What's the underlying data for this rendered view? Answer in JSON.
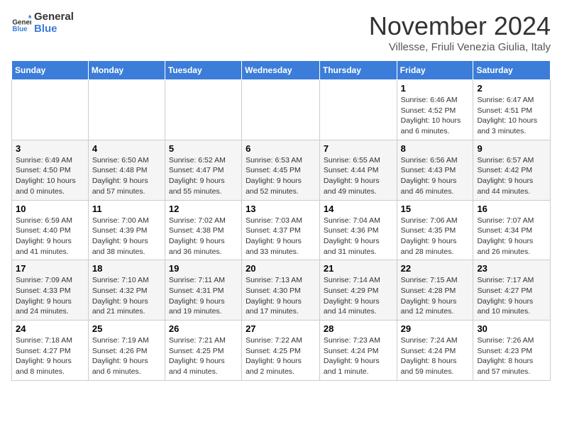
{
  "logo": {
    "line1": "General",
    "line2": "Blue"
  },
  "title": "November 2024",
  "subtitle": "Villesse, Friuli Venezia Giulia, Italy",
  "days_of_week": [
    "Sunday",
    "Monday",
    "Tuesday",
    "Wednesday",
    "Thursday",
    "Friday",
    "Saturday"
  ],
  "weeks": [
    [
      {
        "day": "",
        "info": ""
      },
      {
        "day": "",
        "info": ""
      },
      {
        "day": "",
        "info": ""
      },
      {
        "day": "",
        "info": ""
      },
      {
        "day": "",
        "info": ""
      },
      {
        "day": "1",
        "info": "Sunrise: 6:46 AM\nSunset: 4:52 PM\nDaylight: 10 hours and 6 minutes."
      },
      {
        "day": "2",
        "info": "Sunrise: 6:47 AM\nSunset: 4:51 PM\nDaylight: 10 hours and 3 minutes."
      }
    ],
    [
      {
        "day": "3",
        "info": "Sunrise: 6:49 AM\nSunset: 4:50 PM\nDaylight: 10 hours and 0 minutes."
      },
      {
        "day": "4",
        "info": "Sunrise: 6:50 AM\nSunset: 4:48 PM\nDaylight: 9 hours and 57 minutes."
      },
      {
        "day": "5",
        "info": "Sunrise: 6:52 AM\nSunset: 4:47 PM\nDaylight: 9 hours and 55 minutes."
      },
      {
        "day": "6",
        "info": "Sunrise: 6:53 AM\nSunset: 4:45 PM\nDaylight: 9 hours and 52 minutes."
      },
      {
        "day": "7",
        "info": "Sunrise: 6:55 AM\nSunset: 4:44 PM\nDaylight: 9 hours and 49 minutes."
      },
      {
        "day": "8",
        "info": "Sunrise: 6:56 AM\nSunset: 4:43 PM\nDaylight: 9 hours and 46 minutes."
      },
      {
        "day": "9",
        "info": "Sunrise: 6:57 AM\nSunset: 4:42 PM\nDaylight: 9 hours and 44 minutes."
      }
    ],
    [
      {
        "day": "10",
        "info": "Sunrise: 6:59 AM\nSunset: 4:40 PM\nDaylight: 9 hours and 41 minutes."
      },
      {
        "day": "11",
        "info": "Sunrise: 7:00 AM\nSunset: 4:39 PM\nDaylight: 9 hours and 38 minutes."
      },
      {
        "day": "12",
        "info": "Sunrise: 7:02 AM\nSunset: 4:38 PM\nDaylight: 9 hours and 36 minutes."
      },
      {
        "day": "13",
        "info": "Sunrise: 7:03 AM\nSunset: 4:37 PM\nDaylight: 9 hours and 33 minutes."
      },
      {
        "day": "14",
        "info": "Sunrise: 7:04 AM\nSunset: 4:36 PM\nDaylight: 9 hours and 31 minutes."
      },
      {
        "day": "15",
        "info": "Sunrise: 7:06 AM\nSunset: 4:35 PM\nDaylight: 9 hours and 28 minutes."
      },
      {
        "day": "16",
        "info": "Sunrise: 7:07 AM\nSunset: 4:34 PM\nDaylight: 9 hours and 26 minutes."
      }
    ],
    [
      {
        "day": "17",
        "info": "Sunrise: 7:09 AM\nSunset: 4:33 PM\nDaylight: 9 hours and 24 minutes."
      },
      {
        "day": "18",
        "info": "Sunrise: 7:10 AM\nSunset: 4:32 PM\nDaylight: 9 hours and 21 minutes."
      },
      {
        "day": "19",
        "info": "Sunrise: 7:11 AM\nSunset: 4:31 PM\nDaylight: 9 hours and 19 minutes."
      },
      {
        "day": "20",
        "info": "Sunrise: 7:13 AM\nSunset: 4:30 PM\nDaylight: 9 hours and 17 minutes."
      },
      {
        "day": "21",
        "info": "Sunrise: 7:14 AM\nSunset: 4:29 PM\nDaylight: 9 hours and 14 minutes."
      },
      {
        "day": "22",
        "info": "Sunrise: 7:15 AM\nSunset: 4:28 PM\nDaylight: 9 hours and 12 minutes."
      },
      {
        "day": "23",
        "info": "Sunrise: 7:17 AM\nSunset: 4:27 PM\nDaylight: 9 hours and 10 minutes."
      }
    ],
    [
      {
        "day": "24",
        "info": "Sunrise: 7:18 AM\nSunset: 4:27 PM\nDaylight: 9 hours and 8 minutes."
      },
      {
        "day": "25",
        "info": "Sunrise: 7:19 AM\nSunset: 4:26 PM\nDaylight: 9 hours and 6 minutes."
      },
      {
        "day": "26",
        "info": "Sunrise: 7:21 AM\nSunset: 4:25 PM\nDaylight: 9 hours and 4 minutes."
      },
      {
        "day": "27",
        "info": "Sunrise: 7:22 AM\nSunset: 4:25 PM\nDaylight: 9 hours and 2 minutes."
      },
      {
        "day": "28",
        "info": "Sunrise: 7:23 AM\nSunset: 4:24 PM\nDaylight: 9 hours and 1 minute."
      },
      {
        "day": "29",
        "info": "Sunrise: 7:24 AM\nSunset: 4:24 PM\nDaylight: 8 hours and 59 minutes."
      },
      {
        "day": "30",
        "info": "Sunrise: 7:26 AM\nSunset: 4:23 PM\nDaylight: 8 hours and 57 minutes."
      }
    ]
  ]
}
